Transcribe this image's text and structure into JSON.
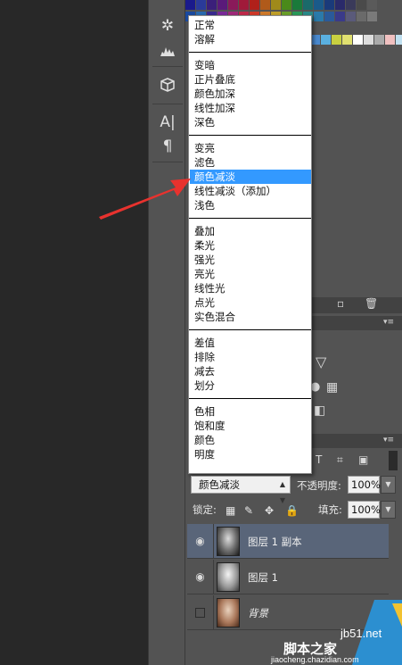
{
  "blend_menu": {
    "groups": [
      [
        "正常",
        "溶解"
      ],
      [
        "变暗",
        "正片叠底",
        "颜色加深",
        "线性加深",
        "深色"
      ],
      [
        "变亮",
        "滤色",
        "颜色减淡",
        "线性减淡（添加）",
        "浅色"
      ],
      [
        "叠加",
        "柔光",
        "强光",
        "亮光",
        "线性光",
        "点光",
        "实色混合"
      ],
      [
        "差值",
        "排除",
        "减去",
        "划分"
      ],
      [
        "色相",
        "饱和度",
        "颜色",
        "明度"
      ]
    ],
    "selected": "颜色减淡"
  },
  "layers_panel": {
    "blend_mode_value": "颜色减淡",
    "opacity_label": "不透明度:",
    "opacity_value": "100%",
    "lock_label": "锁定:",
    "fill_label": "填充:",
    "fill_value": "100%",
    "layers": [
      {
        "name": "图层 1 副本",
        "visible": true,
        "selected": true
      },
      {
        "name": "图层 1",
        "visible": true,
        "selected": false
      },
      {
        "name": "背景",
        "visible": false,
        "selected": false
      }
    ]
  },
  "tools": [
    "compass-icon",
    "histogram-icon",
    "3d-cube-icon",
    "character-icon",
    "paragraph-icon"
  ],
  "watermark": {
    "site": "jb51.net",
    "brand": "脚本之家",
    "domain": "jiaocheng.chazidian.com"
  },
  "colors": {
    "selection": "#3399ff",
    "selected_layer": "#596579",
    "arrow": "#e8322e"
  }
}
